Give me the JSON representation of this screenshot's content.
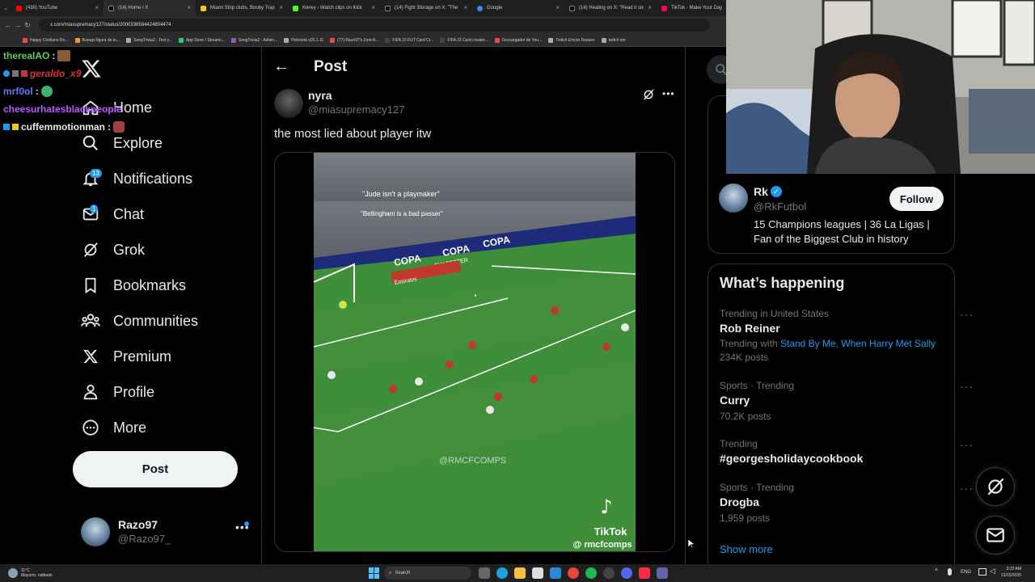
{
  "browser": {
    "tabs": [
      {
        "label": "(435) YouTube",
        "color": "#ff0000"
      },
      {
        "label": "(14) Home / X",
        "color": "#ffffff"
      },
      {
        "label": "Miami Strip clubs, Booby Trap",
        "color": "#f5c518"
      },
      {
        "label": "Kenvy - Watch clips on Kick",
        "color": "#53fc18"
      },
      {
        "label": "(14) Fight Storage on X: \"The",
        "color": "#ffffff"
      },
      {
        "label": "Google",
        "color": "#4285f4"
      },
      {
        "label": "(14) Healing on X: \"Read it six",
        "color": "#ffffff"
      },
      {
        "label": "TikTok - Make Your Day",
        "color": "#ff0050"
      }
    ],
    "url": "x.com/miasupremacy127/status/2000336584424804474",
    "bookmarks": [
      {
        "label": "Happy Cristiano Ro...",
        "color": "#e74c3c"
      },
      {
        "label": "Burago figura de to...",
        "color": "#f39c12"
      },
      {
        "label": "SongTrivia2 - Test y...",
        "color": "#aaaaaa"
      },
      {
        "label": "App Store / Streami...",
        "color": "#2ecc71"
      },
      {
        "label": "SongTrivia2 - Adivin...",
        "color": "#9b59b6"
      },
      {
        "label": "Pelotoob v25.1.11",
        "color": "#aaaaaa"
      },
      {
        "label": "(77) Razo97's Zest-A...",
        "color": "#e74c3c"
      },
      {
        "label": "FIFA 23 FUT Card Cr...",
        "color": "#444444"
      },
      {
        "label": "FIFA 23 Card creator...",
        "color": "#444444"
      },
      {
        "label": "Descargador de You...",
        "color": "#e74c3c"
      },
      {
        "label": "Twitch Emote Resizer",
        "color": "#aaaaaa"
      },
      {
        "label": "twitch em",
        "color": "#aaaaaa"
      }
    ]
  },
  "chat": [
    {
      "user": "therealAO",
      "color": "#5fc95f"
    },
    {
      "user": "geraldo_x9",
      "color": "#d93333"
    },
    {
      "user": "mrf0ol",
      "color": "#5b7bff"
    },
    {
      "user": "cheesurhatesblackpeople",
      "color": "#b45cff"
    },
    {
      "user": "cuffemmotionman",
      "color": "#e7e9ea"
    }
  ],
  "sidebar": {
    "items": [
      {
        "label": "Home"
      },
      {
        "label": "Explore"
      },
      {
        "label": "Notifications",
        "badge": "13"
      },
      {
        "label": "Chat",
        "badge": "1"
      },
      {
        "label": "Grok"
      },
      {
        "label": "Bookmarks"
      },
      {
        "label": "Communities"
      },
      {
        "label": "Premium"
      },
      {
        "label": "Profile"
      },
      {
        "label": "More"
      }
    ],
    "post_label": "Post",
    "profile": {
      "name": "Razo97",
      "handle": "@Razo97_"
    }
  },
  "post": {
    "header": "Post",
    "author_name": "nyra",
    "author_handle": "@miasupremacy127",
    "text": "the most lied about player itw",
    "video": {
      "caption1": "\"Jude isn't a playmaker\"",
      "caption2": "\"Bellingham is a bad passer\"",
      "ad1": "COPA",
      "ad2": "COPA",
      "ad3": "COPA",
      "ad4": "FLY BETTER",
      "ad5": "Emirates",
      "watermark": "@RMCFCOMPS",
      "tiktok": "TikTok",
      "tiktok_handle": "@ rmcfcomps"
    }
  },
  "right": {
    "follow": {
      "name": "Rk",
      "handle": "@RkFutbol",
      "bio": "15 Champions leagues | 36 La Ligas | Fan of the Biggest Club in history",
      "button": "Follow"
    },
    "happening_title": "What’s happening",
    "trends": [
      {
        "meta": "Trending in United States",
        "title": "Rob Reiner",
        "with_label": "Trending with",
        "with_links": "Stand By Me, When Harry Met Sally",
        "count": "234K posts"
      },
      {
        "meta": "Sports · Trending",
        "title": "Curry",
        "count": "70.2K posts"
      },
      {
        "meta": "Trending",
        "title": "#georgesholidaycookbook",
        "count": ""
      },
      {
        "meta": "Sports · Trending",
        "title": "Drogba",
        "count": "1,959 posts"
      }
    ],
    "show_more": "Show more"
  },
  "taskbar": {
    "weather_temp": "11°C",
    "weather_desc": "Mayorm. nublado",
    "search": "Search",
    "lang": "ENG",
    "time": "3:22 AM",
    "date": "12/15/2025"
  }
}
